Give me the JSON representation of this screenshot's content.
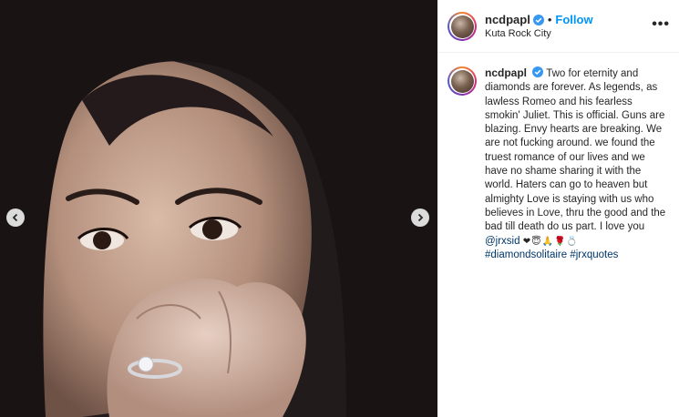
{
  "post": {
    "author": {
      "username": "ncdpapl",
      "verified": true,
      "follow_label": "Follow",
      "location": "Kuta Rock City"
    },
    "more_label": "•••",
    "caption": {
      "username": "ncdpapl",
      "text": "Two for eternity and diamonds are forever. As legends, as lawless Romeo and his fearless smokin' Juliet. This is official. Guns are blazing. Envy hearts are breaking. We are not fucking around. we found the truest romance of our lives and we have no shame sharing it with the world. Haters can go to heaven but almighty Love is staying with us who believes in Love, thru the good and the bad till death do us part. I love you",
      "mention": "@jrxsid",
      "emojis": "❤😇🙏🌹💍",
      "hashtags": [
        "#diamondsolitaire",
        "#jrxquotes"
      ]
    },
    "photo": {
      "alt_subject": "woman with dark hair covering mouth with hand wearing diamond ring"
    },
    "colors": {
      "follow": "#0095f6",
      "verified": "#3897f0",
      "link": "#00376b"
    },
    "icons": {
      "carousel_prev": "chevron-left-icon",
      "carousel_next": "chevron-right-icon",
      "verified": "verified-badge-icon"
    }
  }
}
